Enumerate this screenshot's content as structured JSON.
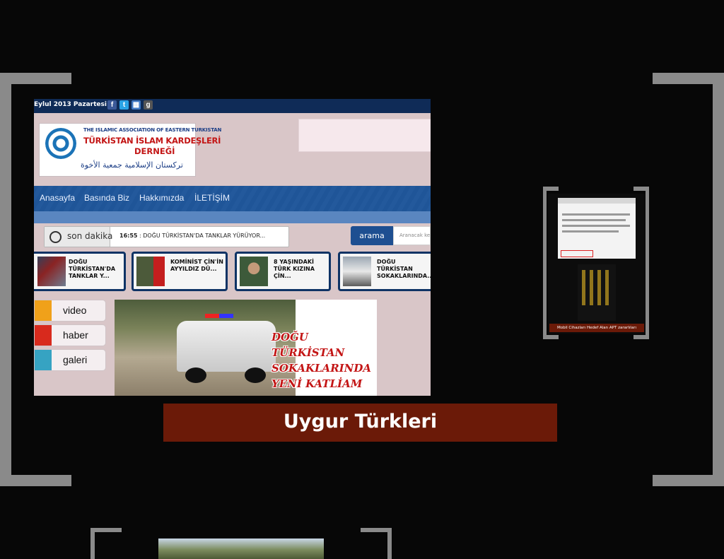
{
  "site": {
    "date": "Eylul 2013 Pazartesi",
    "social": [
      {
        "icon": "facebook-icon",
        "glyph": "f",
        "color": "#3b5998"
      },
      {
        "icon": "twitter-icon",
        "glyph": "t",
        "color": "#2aa3e6"
      },
      {
        "icon": "rss-icon",
        "glyph": "░",
        "color": "#3f78c4"
      },
      {
        "icon": "googleplus-icon",
        "glyph": "g",
        "color": "#555555"
      }
    ],
    "logo": {
      "english": "THE ISLAMIC ASSOCIATION OF EASTERN TURKISTAN",
      "turkish_line1": "TÜRKİSTAN İSLAM KARDEŞLERİ",
      "turkish_line2": "DERNEĞİ",
      "arabic": "تركستان الإسلامية جمعية الأخوة"
    },
    "nav": [
      "Anasayfa",
      "Basında Biz",
      "Hakkımızda",
      "İLETİŞİM"
    ],
    "ticker": {
      "label": "son dakika",
      "time": "16:55",
      "text": ": DOĞU TÜRKİSTAN'DA TANKLAR YÜRÜYOR..."
    },
    "search": {
      "button": "arama",
      "placeholder": "Aranacak ke"
    },
    "cards": [
      {
        "title": "DOĞU TÜRKİSTAN'DA TANKLAR Y..."
      },
      {
        "title": "KOMİNİST ÇİN'İN AYYILDIZ DÜ..."
      },
      {
        "title": "8 YAŞINDAKİ TÜRK KIZINA ÇİN..."
      },
      {
        "title": "DOĞU TÜRKİSTAN SOKAKLARINDA..."
      }
    ],
    "media_links": [
      "video",
      "haber",
      "galeri"
    ],
    "featured_headline": [
      "DOĞU",
      "TÜRKİSTAN",
      "SOKAKLARINDA",
      "YENİ KATLİAM"
    ]
  },
  "caption": "Uygur Türkleri",
  "side_thumbnail": {
    "caption": "Mobil Cihazları Hedef Alan APT zararlıları"
  },
  "colors": {
    "caption_bg": "#6b1a08",
    "nav_bg": "#1f5598",
    "headline_red": "#c31515",
    "frame_gray": "#8a8a8a"
  }
}
